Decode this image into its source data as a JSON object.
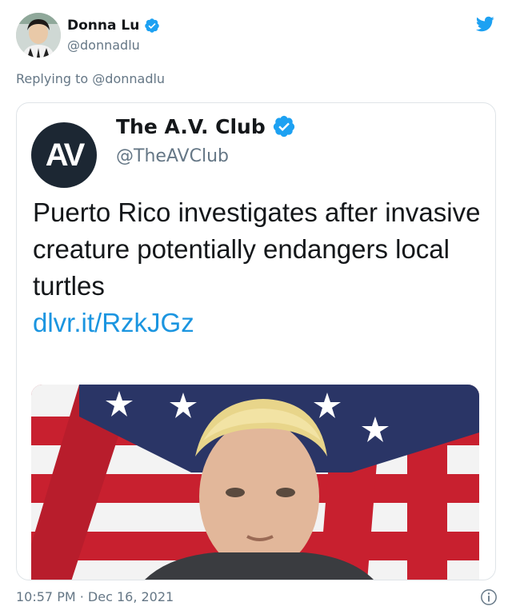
{
  "author": {
    "name": "Donna Lu",
    "handle": "@donnadlu",
    "avatar_icon": "profile-photo"
  },
  "replying": {
    "prefix": "Replying to",
    "mention": "@donnadlu"
  },
  "quoted_tweet": {
    "logo_text": "AV",
    "name": "The A.V. Club",
    "handle": "@TheAVClub",
    "text": "Puerto Rico investigates after invasive creature potentially endangers local turtles",
    "link": "dlvr.it/RzkJGz",
    "media_icon": "photo-flag-portrait"
  },
  "meta": {
    "timestamp": "10:57 PM · Dec 16, 2021"
  },
  "colors": {
    "brand_blue": "#1da1f2",
    "link_blue": "#1b95e0",
    "muted_gray": "#657786",
    "av_logo_bg": "#1c2733"
  },
  "icons": {
    "verified": "verified-badge-icon",
    "twitter": "twitter-bird-icon",
    "info": "info-icon"
  }
}
